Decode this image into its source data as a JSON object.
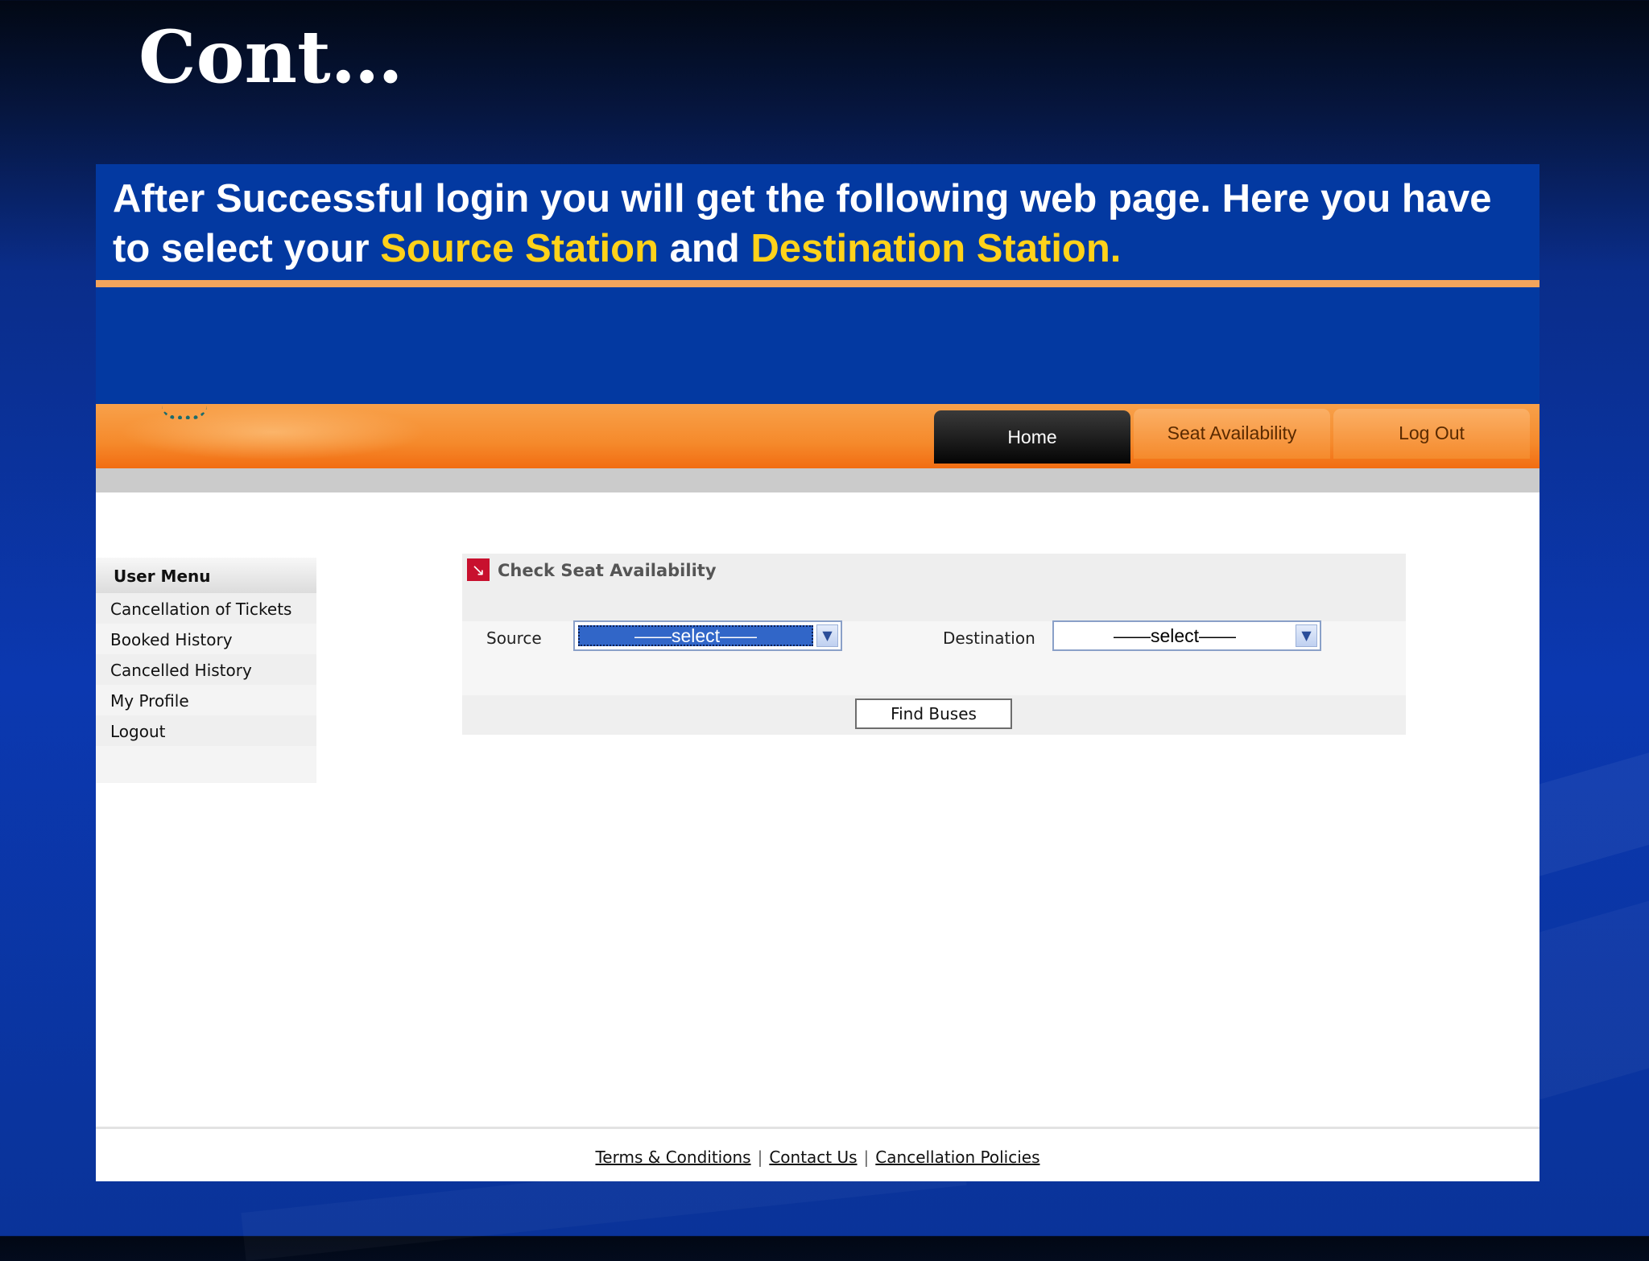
{
  "slide": {
    "title": "Cont…",
    "caption_part1": "After Successful login you will get the following web page. Here you have to select your ",
    "caption_source": "Source Station",
    "caption_and": " and ",
    "caption_destination": "Destination Station."
  },
  "nav": {
    "home": "Home",
    "seat_availability": "Seat Availability",
    "log_out": "Log Out"
  },
  "user_menu": {
    "title": "User Menu",
    "items": [
      {
        "label": "Cancellation of Tickets"
      },
      {
        "label": "Booked History"
      },
      {
        "label": "Cancelled History"
      },
      {
        "label": "My Profile"
      },
      {
        "label": "Logout"
      }
    ]
  },
  "seat_panel": {
    "title": "Check Seat Availability",
    "source_label": "Source",
    "source_value": "——select——",
    "destination_label": "Destination",
    "destination_value": "——select——",
    "find_button": "Find Buses"
  },
  "footer": {
    "links": [
      "Terms & Conditions",
      "Contact Us",
      "Cancellation Policies"
    ],
    "separator": "|"
  },
  "colors": {
    "slide_bg": "#0b38b0",
    "caption_bg": "#0339a1",
    "highlight": "#ffd21a",
    "nav_orange": "#f58a2c",
    "active_tab": "#050505",
    "select_active": "#3166c8"
  },
  "icons": {
    "panel_icon": "arrow-square-icon",
    "dropdown": "chevron-down-icon"
  }
}
